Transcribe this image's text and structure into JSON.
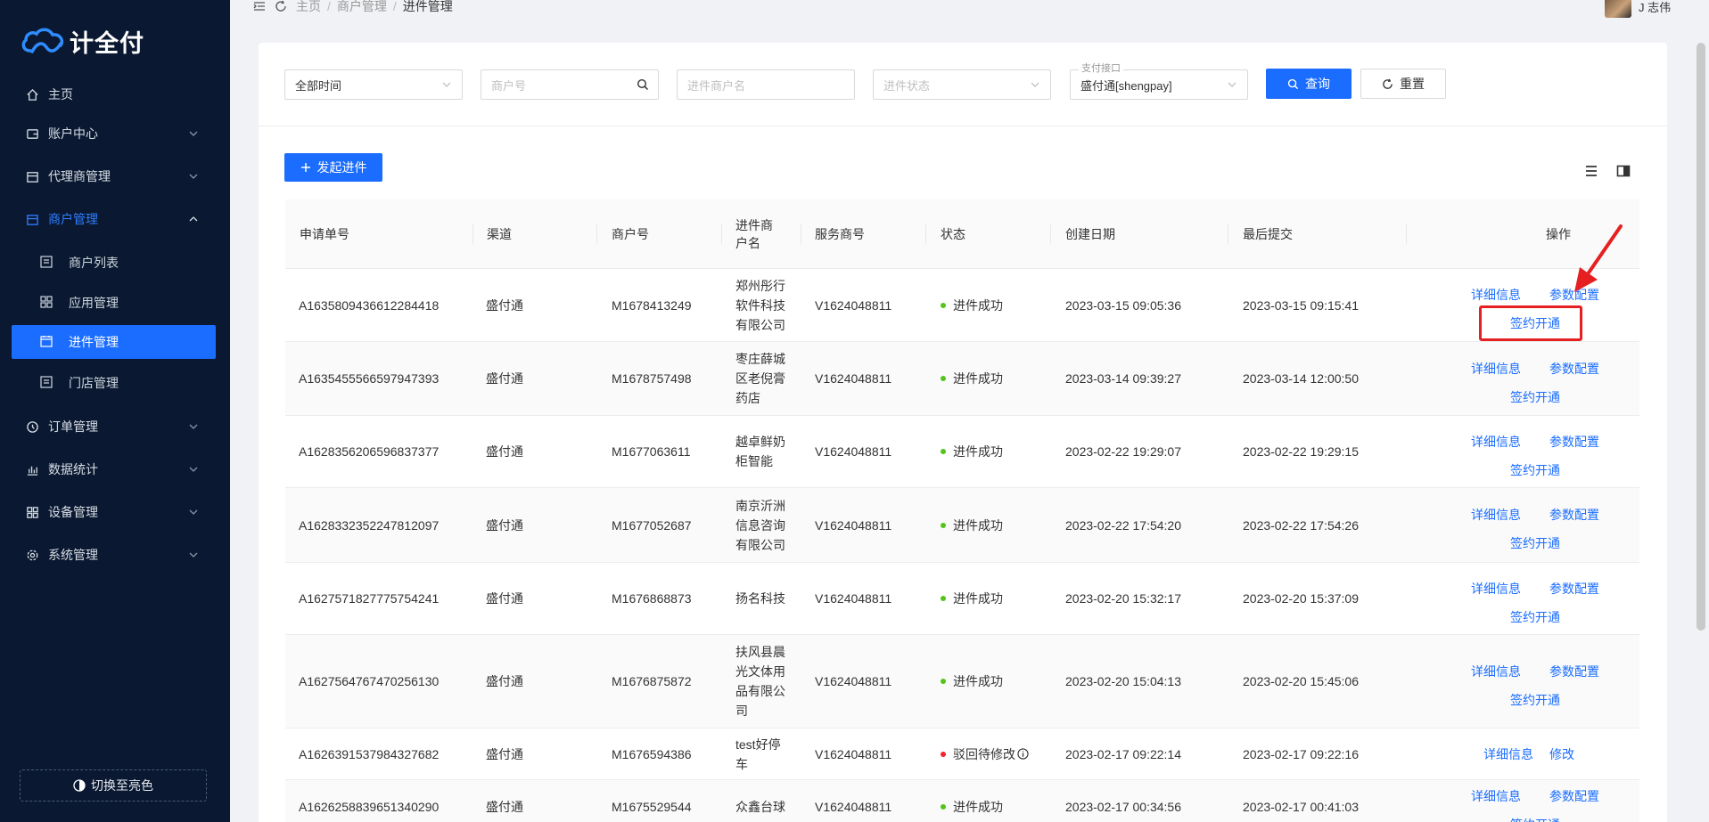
{
  "app": {
    "logo_text": "计全付"
  },
  "sidebar": {
    "home": "主页",
    "account": "账户中心",
    "agent": "代理商管理",
    "merchant": "商户管理",
    "merchant_list": "商户列表",
    "app_manage": "应用管理",
    "onboarding": "进件管理",
    "store": "门店管理",
    "order": "订单管理",
    "stats": "数据统计",
    "device": "设备管理",
    "system": "系统管理",
    "theme_toggle": "切换至亮色"
  },
  "breadcrumb": {
    "home": "主页",
    "parent": "商户管理",
    "current": "进件管理"
  },
  "user": {
    "name": "J 志伟"
  },
  "filters": {
    "time_value": "全部时间",
    "merchant_no_ph": "商户号",
    "merchant_name_ph": "进件商户名",
    "status_ph": "进件状态",
    "iface_label": "支付接口",
    "iface_value": "盛付通[shengpay]",
    "query": "查询",
    "reset": "重置"
  },
  "actions": {
    "create": "发起进件"
  },
  "table": {
    "headers": [
      "申请单号",
      "渠道",
      "商户号",
      "进件商户名",
      "服务商号",
      "状态",
      "创建日期",
      "最后提交",
      "操作"
    ],
    "header_name_lines": [
      "进件商",
      "户名"
    ],
    "op_labels": {
      "detail": "详细信息",
      "params": "参数配置",
      "sign": "签约开通",
      "edit": "修改"
    },
    "rows": [
      {
        "id": "A1635809436612284418",
        "channel": "盛付通",
        "mch": "M1678413249",
        "name_lines": [
          "郑州彤行",
          "软件科技",
          "有限公司"
        ],
        "svc": "V1624048811",
        "status": "进件成功",
        "status_color": "#52c41a",
        "created": "2023-03-15 09:05:36",
        "last": "2023-03-15 09:15:41"
      },
      {
        "id": "A1635455566597947393",
        "channel": "盛付通",
        "mch": "M1678757498",
        "name_lines": [
          "枣庄薛城",
          "区老倪膏",
          "药店"
        ],
        "svc": "V1624048811",
        "status": "进件成功",
        "status_color": "#52c41a",
        "created": "2023-03-14 09:39:27",
        "last": "2023-03-14 12:00:50"
      },
      {
        "id": "A1628356206596837377",
        "channel": "盛付通",
        "mch": "M1677063611",
        "name_lines": [
          "越卓鲜奶",
          "柜智能"
        ],
        "svc": "V1624048811",
        "status": "进件成功",
        "status_color": "#52c41a",
        "created": "2023-02-22 19:29:07",
        "last": "2023-02-22 19:29:15"
      },
      {
        "id": "A1628332352247812097",
        "channel": "盛付通",
        "mch": "M1677052687",
        "name_lines": [
          "南京沂洲",
          "信息咨询",
          "有限公司"
        ],
        "svc": "V1624048811",
        "status": "进件成功",
        "status_color": "#52c41a",
        "created": "2023-02-22 17:54:20",
        "last": "2023-02-22 17:54:26"
      },
      {
        "id": "A1627571827775754241",
        "channel": "盛付通",
        "mch": "M1676868873",
        "name_lines": [
          "扬名科技"
        ],
        "svc": "V1624048811",
        "status": "进件成功",
        "status_color": "#52c41a",
        "created": "2023-02-20 15:32:17",
        "last": "2023-02-20 15:37:09"
      },
      {
        "id": "A1627564767470256130",
        "channel": "盛付通",
        "mch": "M1676875872",
        "name_lines": [
          "扶风县晨",
          "光文体用",
          "品有限公",
          "司"
        ],
        "svc": "V1624048811",
        "status": "进件成功",
        "status_color": "#52c41a",
        "created": "2023-02-20 15:04:13",
        "last": "2023-02-20 15:45:06"
      },
      {
        "id": "A1626391537984327682",
        "channel": "盛付通",
        "mch": "M1676594386",
        "name_lines": [
          "test好停",
          "车"
        ],
        "svc": "V1624048811",
        "status": "驳回待修改",
        "status_color": "#f5222d",
        "created": "2023-02-17 09:22:14",
        "last": "2023-02-17 09:22:16"
      },
      {
        "id": "A1626258839651340290",
        "channel": "盛付通",
        "mch": "M1675529544",
        "name_lines": [
          "众鑫台球"
        ],
        "svc": "V1624048811",
        "status": "进件成功",
        "status_color": "#52c41a",
        "created": "2023-02-17 00:34:56",
        "last": "2023-02-17 00:41:03"
      }
    ]
  },
  "colors": {
    "primary": "#1a6dff",
    "sidebar_bg": "#0a1931",
    "success": "#52c41a",
    "danger": "#f5222d",
    "highlight": "#e62020"
  }
}
